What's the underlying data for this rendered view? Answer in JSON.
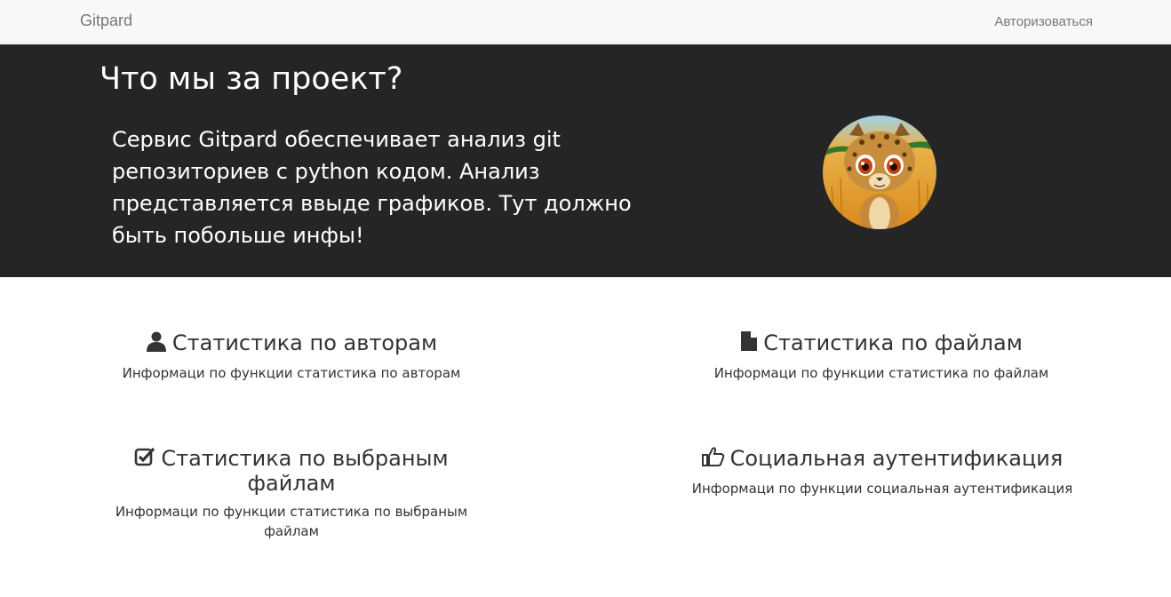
{
  "navbar": {
    "brand": "Gitpard",
    "login": "Авторизоваться"
  },
  "hero": {
    "title": "Что мы за проект?",
    "text": "Сервис Gitpard обеспечивает анализ git репозиториев с python кодом. Анализ представляется ввыде графиков. Тут должно быть побольше инфы!",
    "avatar_icon": "cartoon-leopard-avatar"
  },
  "features": [
    {
      "icon": "user-icon",
      "title": "Статистика по авторам",
      "description": "Информаци по функции статистика по авторам"
    },
    {
      "icon": "file-icon",
      "title": "Статистика по файлам",
      "description": "Информаци по функции статистика по файлам"
    },
    {
      "icon": "check-square-icon",
      "title": "Статистика по выбраным файлам",
      "description": "Информаци по функции статистика по выбраным файлам"
    },
    {
      "icon": "thumbs-up-icon",
      "title": "Социальная аутентификация",
      "description": "Информаци по функции социальная аутентификация"
    }
  ],
  "colors": {
    "navbar_bg": "#f8f8f8",
    "hero_bg": "#252525",
    "text": "#333333",
    "nav_text": "#777777"
  }
}
